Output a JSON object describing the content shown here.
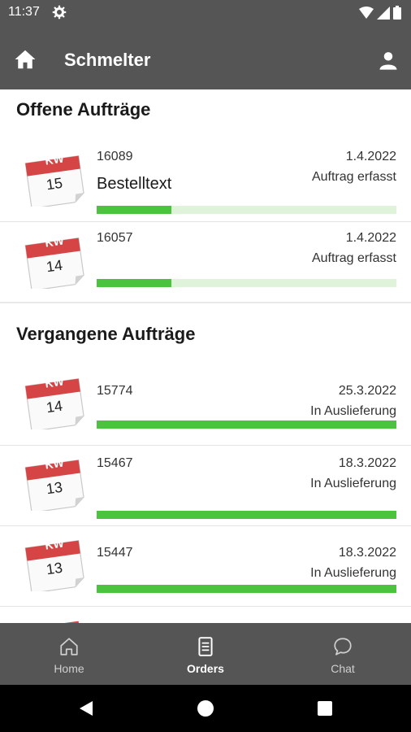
{
  "status_bar": {
    "time": "11:37"
  },
  "app_bar": {
    "title": "Schmelter"
  },
  "sections": {
    "open_title": "Offene Aufträge",
    "past_title": "Vergangene Aufträge"
  },
  "calendar_prefix": "KW",
  "open_orders": [
    {
      "week": "15",
      "number": "16089",
      "date": "1.4.2022",
      "status": "Auftrag erfasst",
      "text": "Bestelltext",
      "progress": 0.25
    },
    {
      "week": "14",
      "number": "16057",
      "date": "1.4.2022",
      "status": "Auftrag erfasst",
      "text": "",
      "progress": 0.25
    }
  ],
  "past_orders": [
    {
      "week": "14",
      "number": "15774",
      "date": "25.3.2022",
      "status": "In Auslieferung",
      "progress": 1.0
    },
    {
      "week": "13",
      "number": "15467",
      "date": "18.3.2022",
      "status": "In Auslieferung",
      "progress": 1.0
    },
    {
      "week": "13",
      "number": "15447",
      "date": "18.3.2022",
      "status": "In Auslieferung",
      "progress": 1.0
    }
  ],
  "bottom_nav": [
    {
      "label": "Home",
      "icon": "home-icon",
      "active": false
    },
    {
      "label": "Orders",
      "icon": "orders-icon",
      "active": true
    },
    {
      "label": "Chat",
      "icon": "chat-icon",
      "active": false
    }
  ],
  "colors": {
    "bar": "#555555",
    "calendar_red": "#d64545",
    "progress_fill": "#4cc33f",
    "progress_track": "#dff2da"
  }
}
